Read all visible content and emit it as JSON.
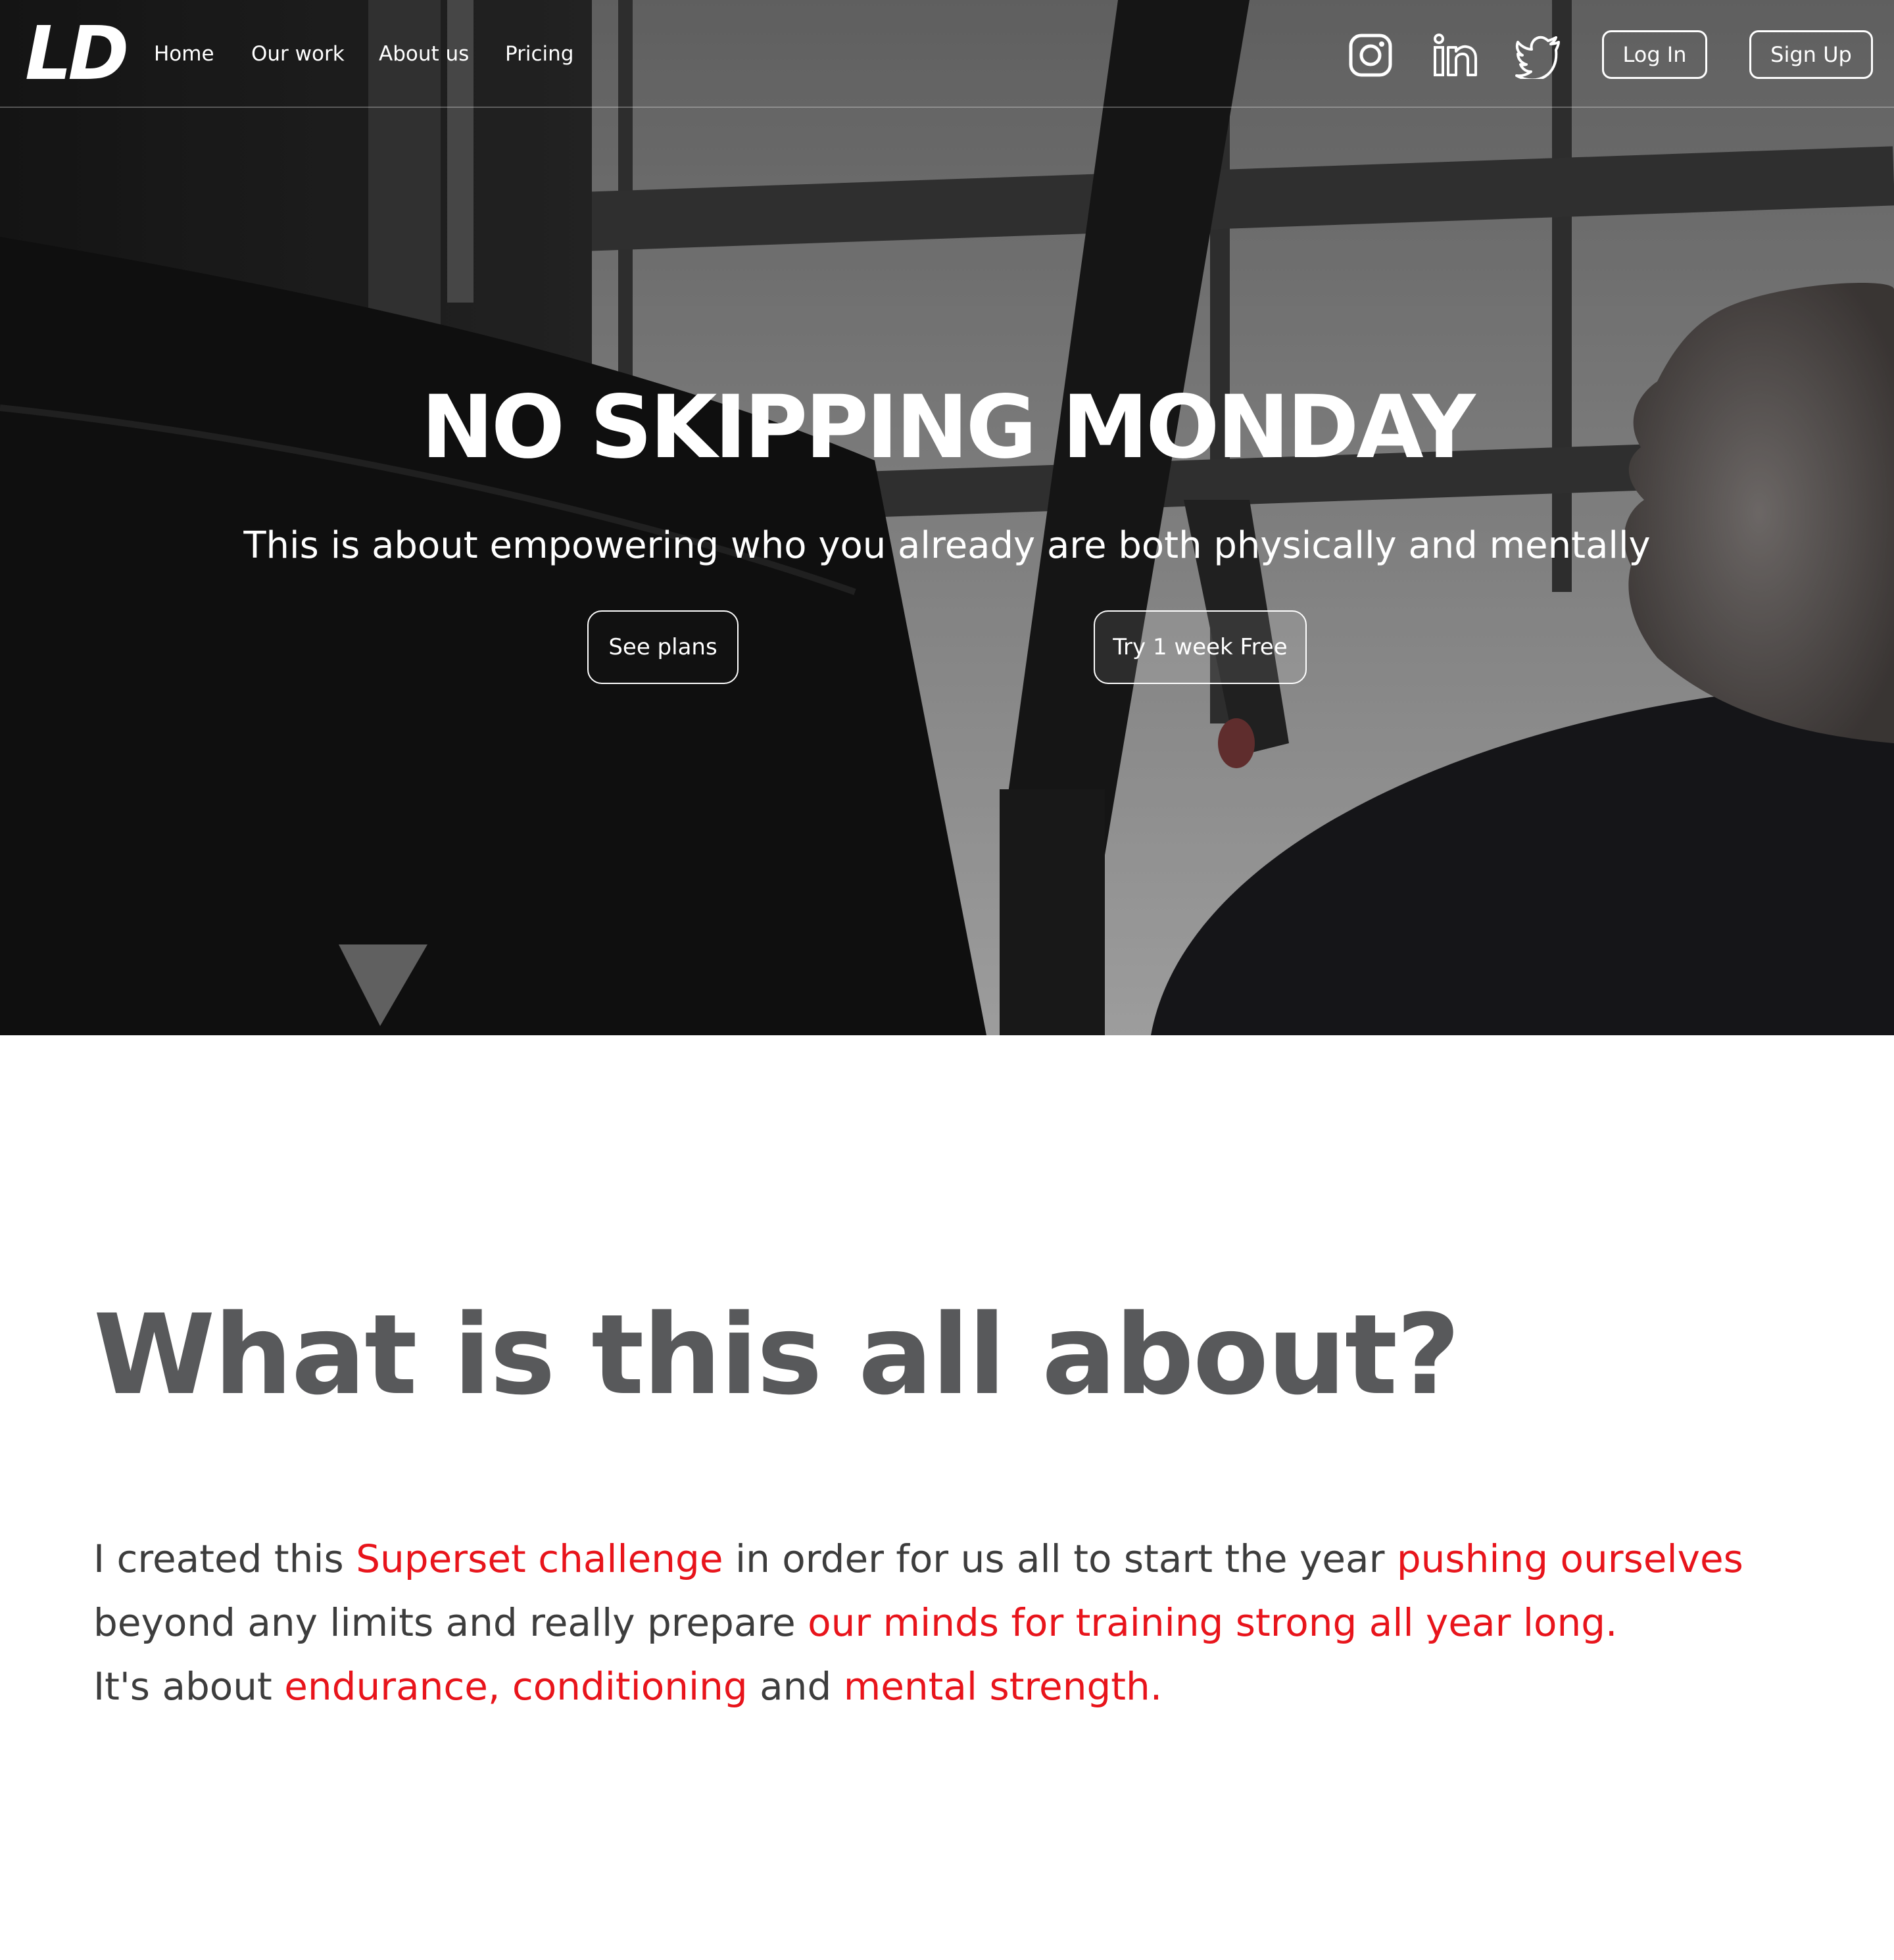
{
  "brand": {
    "logo_text": "LD"
  },
  "nav": {
    "links": [
      "Home",
      "Our work",
      "About us",
      "Pricing"
    ],
    "social_icons": [
      "instagram-icon",
      "linkedin-icon",
      "twitter-icon"
    ],
    "login_label": "Log In",
    "signup_label": "Sign Up"
  },
  "hero": {
    "title": "NO SKIPPING MONDAY",
    "subtitle": "This is about empowering who you already are both physically and mentally",
    "primary_cta": "See plans",
    "secondary_cta": "Try 1 week Free"
  },
  "about": {
    "heading": "What is this all about?",
    "p1": "I created this ",
    "p2": "Superset challenge",
    "p3": " in order for us all to start the year ",
    "p4": "pushing ourselves",
    "p5": " beyond any limits and really prepare ",
    "p6": "our minds for training strong all year long",
    "p7": ".",
    "p8": "It's about ",
    "p9": "endurance, conditioning",
    "p10": " and ",
    "p11": "mental strength",
    "p12": "."
  },
  "colors": {
    "accent": "#e8141b",
    "heading_gray": "#58595b",
    "body_text": "#3d3d3d",
    "white": "#ffffff"
  }
}
